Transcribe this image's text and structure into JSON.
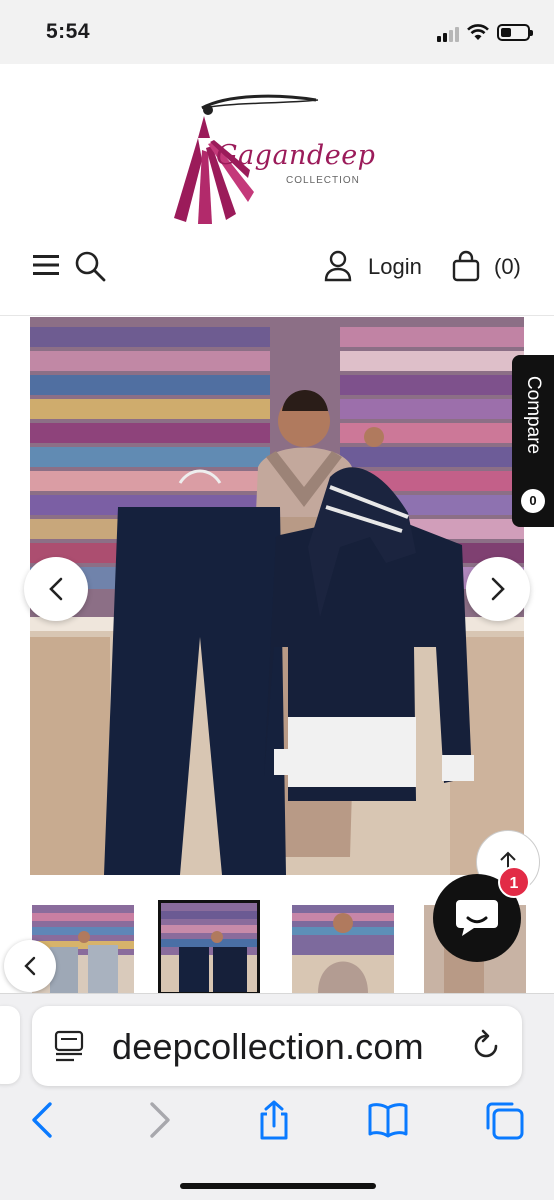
{
  "status_bar": {
    "time": "5:54"
  },
  "header": {
    "brand_name": "Gagandeep",
    "brand_sub": "COLLECTION",
    "login_label": "Login",
    "cart_count": "(0)"
  },
  "product": {
    "compare_label": "Compare",
    "compare_count": "0"
  },
  "chat": {
    "badge_count": "1"
  },
  "browser": {
    "url": "deepcollection.com"
  },
  "colors": {
    "brand": "#9b1b5a",
    "dark": "#111111",
    "badge": "#e22b46",
    "ios_blue": "#0a7aff"
  }
}
